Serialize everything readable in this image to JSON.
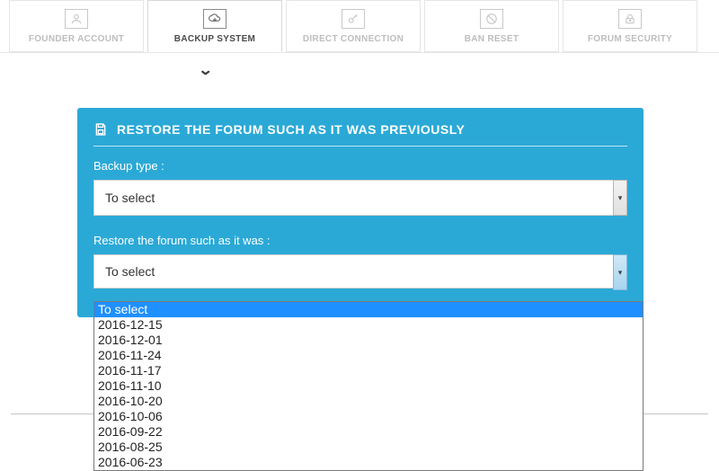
{
  "tabs": {
    "items": [
      {
        "label": "FOUNDER ACCOUNT",
        "name": "tab-founder-account"
      },
      {
        "label": "BACKUP SYSTEM",
        "name": "tab-backup-system"
      },
      {
        "label": "DIRECT CONNECTION",
        "name": "tab-direct-connection"
      },
      {
        "label": "BAN RESET",
        "name": "tab-ban-reset"
      },
      {
        "label": "FORUM SECURITY",
        "name": "tab-forum-security"
      }
    ],
    "active_index": 1
  },
  "panel": {
    "title": "RESTORE THE FORUM SUCH AS IT WAS PREVIOUSLY",
    "backup_type": {
      "label": "Backup type :",
      "value": "To select"
    },
    "restore_as": {
      "label": "Restore the forum such as it was :",
      "value": "To select",
      "options": [
        "To select",
        "2016-12-15",
        "2016-12-01",
        "2016-11-24",
        "2016-11-17",
        "2016-11-10",
        "2016-10-20",
        "2016-10-06",
        "2016-09-22",
        "2016-08-25",
        "2016-06-23"
      ],
      "selected_index": 0
    }
  }
}
